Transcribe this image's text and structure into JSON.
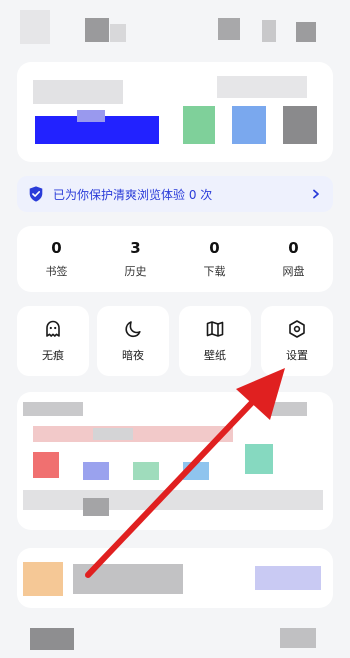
{
  "protection_banner": {
    "text": "已为你保护清爽浏览体验 0 次",
    "icon": "shield-check-icon",
    "chevron": "chevron-right-icon"
  },
  "stats": [
    {
      "value": "0",
      "label": "书签"
    },
    {
      "value": "3",
      "label": "历史"
    },
    {
      "value": "0",
      "label": "下载"
    },
    {
      "value": "0",
      "label": "网盘"
    }
  ],
  "tools": [
    {
      "label": "无痕",
      "icon": "ghost-icon"
    },
    {
      "label": "暗夜",
      "icon": "moon-icon"
    },
    {
      "label": "壁纸",
      "icon": "book-open-icon"
    },
    {
      "label": "设置",
      "icon": "gear-hexagon-icon"
    }
  ],
  "colors": {
    "accent": "#2a3cd9",
    "banner_bg": "#eef1fd",
    "annotation_arrow": "#e02020"
  }
}
